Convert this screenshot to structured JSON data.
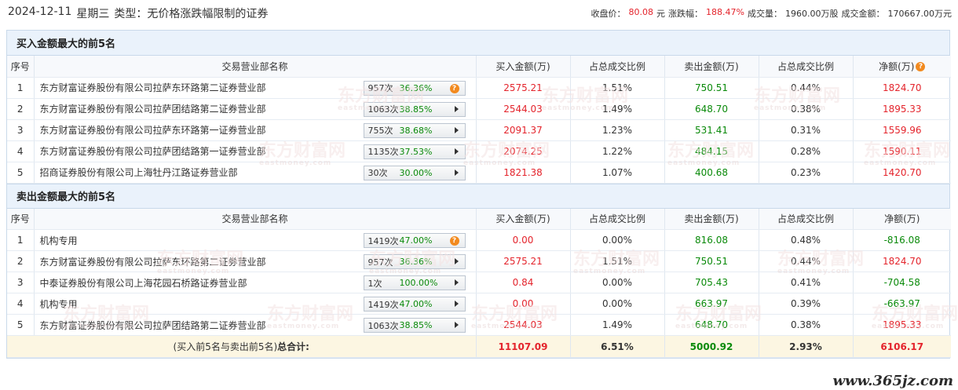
{
  "header": {
    "date": "2024-12-11",
    "weekday": "星期三",
    "type_label": "类型：无价格涨跌幅限制的证券",
    "close_label": "收盘价：",
    "close_value": "80.08",
    "close_unit": "元",
    "change_label": "涨跌幅：",
    "change_value": "188.47%",
    "volume_label": "成交量：",
    "volume_value": "1960.00万股",
    "amount_label": "成交金额：",
    "amount_value": "170667.00万元"
  },
  "columns": {
    "seq": "序号",
    "name": "交易营业部名称",
    "buy": "买入金额(万)",
    "buy_ratio": "占总成交比例",
    "sell": "卖出金额(万)",
    "sell_ratio": "占总成交比例",
    "net": "净额(万)"
  },
  "buy_section": {
    "title": "买入金额最大的前5名",
    "rows": [
      {
        "seq": "1",
        "name": "东方财富证券股份有限公司拉萨东环路第二证券营业部",
        "times": "957次",
        "pct": "36.36%",
        "icon": "question-icon",
        "buy": "2575.21",
        "buy_ratio": "1.51%",
        "sell": "750.51",
        "sell_ratio": "0.44%",
        "net": "1824.70"
      },
      {
        "seq": "2",
        "name": "东方财富证券股份有限公司拉萨团结路第二证券营业部",
        "times": "1063次",
        "pct": "38.85%",
        "icon": "arrow-right-icon",
        "buy": "2544.03",
        "buy_ratio": "1.49%",
        "sell": "648.70",
        "sell_ratio": "0.38%",
        "net": "1895.33"
      },
      {
        "seq": "3",
        "name": "东方财富证券股份有限公司拉萨东环路第一证券营业部",
        "times": "755次",
        "pct": "38.68%",
        "icon": "arrow-right-icon",
        "buy": "2091.37",
        "buy_ratio": "1.23%",
        "sell": "531.41",
        "sell_ratio": "0.31%",
        "net": "1559.96"
      },
      {
        "seq": "4",
        "name": "东方财富证券股份有限公司拉萨团结路第一证券营业部",
        "times": "1135次",
        "pct": "37.53%",
        "icon": "arrow-right-icon",
        "buy": "2074.25",
        "buy_ratio": "1.22%",
        "sell": "484.15",
        "sell_ratio": "0.28%",
        "net": "1590.11"
      },
      {
        "seq": "5",
        "name": "招商证券股份有限公司上海牡丹江路证券营业部",
        "times": "30次",
        "pct": "30.00%",
        "icon": "arrow-right-icon",
        "buy": "1821.38",
        "buy_ratio": "1.07%",
        "sell": "400.68",
        "sell_ratio": "0.23%",
        "net": "1420.70"
      }
    ]
  },
  "sell_section": {
    "title": "卖出金额最大的前5名",
    "rows": [
      {
        "seq": "1",
        "name": "机构专用",
        "times": "1419次",
        "pct": "47.00%",
        "icon": "question-icon",
        "buy": "0.00",
        "buy_ratio": "0.00%",
        "sell": "816.08",
        "sell_ratio": "0.48%",
        "net": "-816.08"
      },
      {
        "seq": "2",
        "name": "东方财富证券股份有限公司拉萨东环路第二证券营业部",
        "times": "957次",
        "pct": "36.36%",
        "icon": "arrow-right-icon",
        "buy": "2575.21",
        "buy_ratio": "1.51%",
        "sell": "750.51",
        "sell_ratio": "0.44%",
        "net": "1824.70"
      },
      {
        "seq": "3",
        "name": "中泰证券股份有限公司上海花园石桥路证券营业部",
        "times": "1次",
        "pct": "100.00%",
        "icon": "arrow-right-icon",
        "buy": "0.84",
        "buy_ratio": "0.00%",
        "sell": "705.43",
        "sell_ratio": "0.41%",
        "net": "-704.58"
      },
      {
        "seq": "4",
        "name": "机构专用",
        "times": "1419次",
        "pct": "47.00%",
        "icon": "arrow-right-icon",
        "buy": "0.00",
        "buy_ratio": "0.00%",
        "sell": "663.97",
        "sell_ratio": "0.39%",
        "net": "-663.97"
      },
      {
        "seq": "5",
        "name": "东方财富证券股份有限公司拉萨团结路第二证券营业部",
        "times": "1063次",
        "pct": "38.85%",
        "icon": "arrow-right-icon",
        "buy": "2544.03",
        "buy_ratio": "1.49%",
        "sell": "648.70",
        "sell_ratio": "0.38%",
        "net": "1895.33"
      }
    ]
  },
  "total": {
    "label_prefix": "(买入前5名与卖出前5名)",
    "label_bold": "总合计:",
    "buy": "11107.09",
    "buy_ratio": "6.51%",
    "sell": "5000.92",
    "sell_ratio": "2.93%",
    "net": "6106.17"
  },
  "watermark": {
    "cn": "东方财富网",
    "en": "eastmoney.com"
  },
  "corner_site": "www.365jz.com",
  "colors": {
    "up": "#e4242c",
    "down": "#0a8a0a",
    "accent_icon": "#f28a1f",
    "section_bg": "#eaf2fb",
    "total_bg": "#fcf6e2"
  }
}
